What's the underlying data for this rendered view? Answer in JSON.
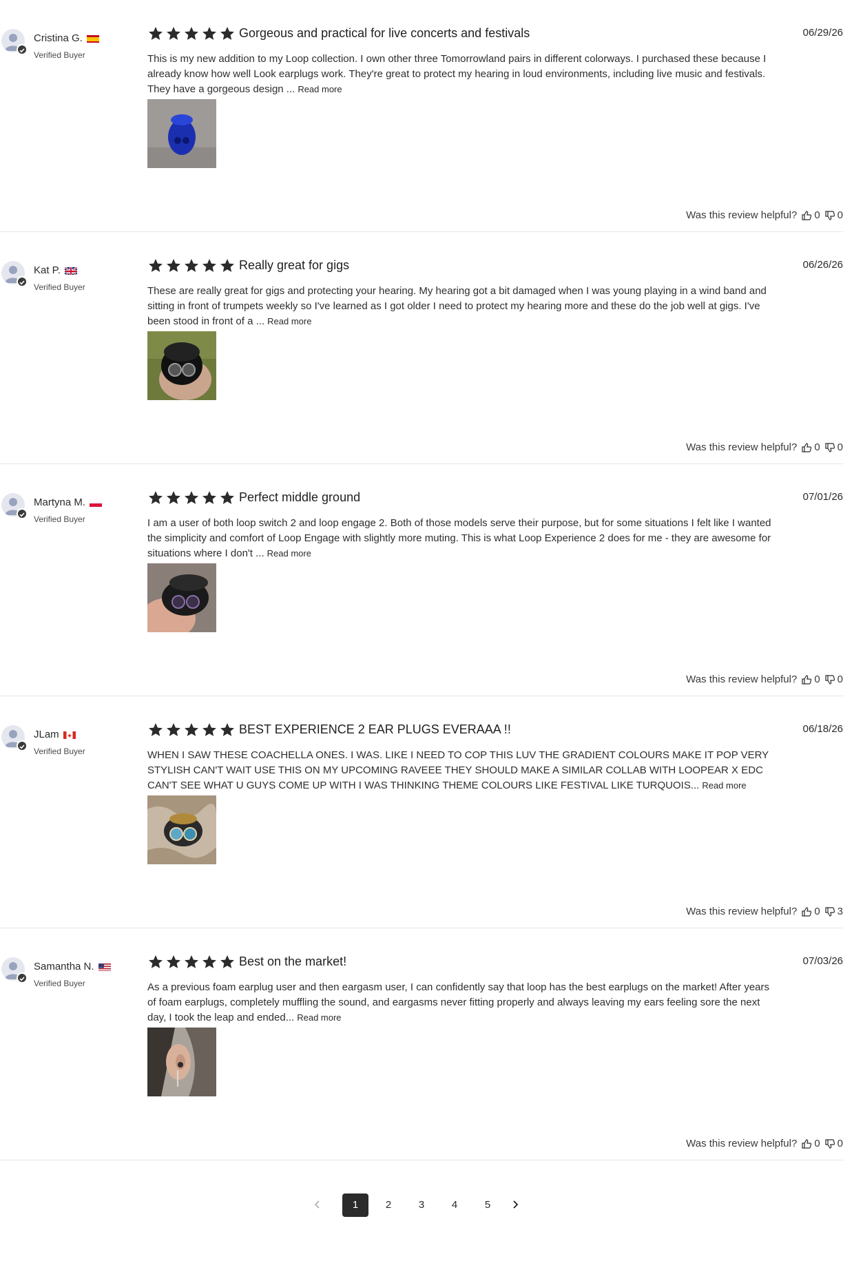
{
  "reviews": [
    {
      "name": "Cristina G.",
      "flag": "spain-flag",
      "verified": "Verified Buyer",
      "rating": 5,
      "title": "Gorgeous and practical for live concerts and festivals",
      "date": "06/29/26",
      "body": "This is my new addition to my Loop collection. I own other three Tomorrowland pairs in different colorways. I purchased these because I already know how well Look earplugs work. They're great to protect my hearing in loud environments, including live music and festivals. They have a gorgeous design ...",
      "read_more": "Read more",
      "helpful_label": "Was this review helpful?",
      "up": "0",
      "down": "0"
    },
    {
      "name": "Kat P.",
      "flag": "uk-flag",
      "verified": "Verified Buyer",
      "rating": 5,
      "title": "Really great for gigs",
      "date": "06/26/26",
      "body": "These are really great for gigs and protecting your hearing. My hearing got a bit damaged when I was young playing in a wind band and sitting in front of trumpets weekly so I've learned as I got older I need to protect my hearing more and these do the job well at gigs. I've been stood in front of a ...",
      "read_more": "Read more",
      "helpful_label": "Was this review helpful?",
      "up": "0",
      "down": "0"
    },
    {
      "name": "Martyna M.",
      "flag": "poland-flag",
      "verified": "Verified Buyer",
      "rating": 5,
      "title": "Perfect middle ground",
      "date": "07/01/26",
      "body": "I am a user of both loop switch 2 and loop engage 2. Both of those models serve their purpose, but for some situations I felt like I wanted the simplicity and comfort of Loop Engage with slightly more muting. This is what Loop Experience 2 does for me - they are awesome for situations where I don't ...",
      "read_more": "Read more",
      "helpful_label": "Was this review helpful?",
      "up": "0",
      "down": "0"
    },
    {
      "name": "JLam",
      "flag": "canada-flag",
      "verified": "Verified Buyer",
      "rating": 5,
      "title": "BEST EXPERIENCE 2 EAR PLUGS EVERAAA !!",
      "date": "06/18/26",
      "body": "WHEN I SAW THESE COACHELLA ONES. I WAS. LIKE I NEED TO COP THIS LUV THE GRADIENT COLOURS MAKE IT POP VERY STYLISH CAN'T WAIT USE THIS ON MY UPCOMING RAVEEE THEY SHOULD MAKE A SIMILAR COLLAB WITH LOOPEAR X EDC CAN'T SEE WHAT U GUYS COME UP WITH I WAS THINKING THEME COLOURS LIKE FESTIVAL LIKE TURQUOIS...",
      "read_more": "Read more",
      "helpful_label": "Was this review helpful?",
      "up": "0",
      "down": "3"
    },
    {
      "name": "Samantha N.",
      "flag": "usa-flag",
      "verified": "Verified Buyer",
      "rating": 5,
      "title": "Best on the market!",
      "date": "07/03/26",
      "body": "As a previous foam earplug user and then eargasm user, I can confidently say that loop has the best earplugs on the market! After years of foam earplugs, completely muffling the sound, and eargasms never fitting properly and always leaving my ears feeling sore the next day, I took the leap and ended...",
      "read_more": "Read more",
      "helpful_label": "Was this review helpful?",
      "up": "0",
      "down": "0"
    }
  ],
  "pagination": {
    "pages": [
      "1",
      "2",
      "3",
      "4",
      "5"
    ],
    "current": "1"
  }
}
